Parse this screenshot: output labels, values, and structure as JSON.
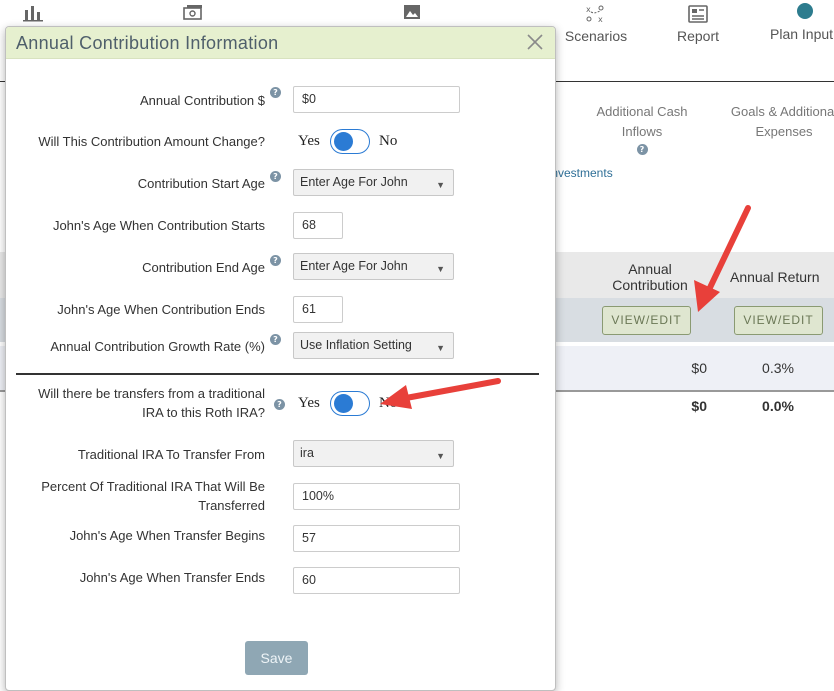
{
  "nav": {
    "items": [
      {
        "label": "",
        "icon": "bar-chart-icon"
      },
      {
        "label": "",
        "icon": "money-icon"
      },
      {
        "label": "",
        "icon": "image-icon"
      },
      {
        "label": "Scenarios",
        "icon": "scenarios-icon"
      },
      {
        "label": "Report",
        "icon": "report-icon"
      },
      {
        "label": "Plan Input",
        "icon": "plan-input-icon"
      }
    ]
  },
  "subtabs": {
    "additional_cash_inflows": "Additional Cash Inflows",
    "goals_expenses": "Goals & Additional Expenses",
    "investments": "Investments"
  },
  "bg_table": {
    "headers": {
      "annual_contribution": "Annual Contribution",
      "annual_return": "Annual Return"
    },
    "view_edit": "VIEW/EDIT",
    "row": {
      "contribution": "$0",
      "return": "0.3%"
    },
    "totals": {
      "contribution": "$0",
      "return": "0.0%"
    }
  },
  "modal": {
    "title": "Annual Contribution Information",
    "fields": {
      "annual_contribution": {
        "label": "Annual Contribution $",
        "value": "$0"
      },
      "amount_change": {
        "label": "Will This Contribution Amount Change?",
        "yes": "Yes",
        "no": "No",
        "state": "off"
      },
      "start_age": {
        "label": "Contribution Start Age",
        "value": "Enter Age For John"
      },
      "age_when_starts": {
        "label": "John's Age When Contribution Starts",
        "value": "68"
      },
      "end_age": {
        "label": "Contribution End Age",
        "value": "Enter Age For John"
      },
      "age_when_ends": {
        "label": "John's Age When Contribution Ends",
        "value": "61"
      },
      "growth_rate": {
        "label": "Annual Contribution Growth Rate (%)",
        "value": "Use Inflation Setting"
      },
      "transfers": {
        "label": "Will there be transfers from a traditional IRA to this Roth IRA?",
        "yes": "Yes",
        "no": "No",
        "state": "off"
      },
      "transfer_from": {
        "label": "Traditional IRA To Transfer From",
        "value": "ira"
      },
      "percent_transferred": {
        "label": "Percent Of Traditional IRA That Will Be Transferred",
        "value": "100%"
      },
      "transfer_begins": {
        "label": "John's Age When Transfer Begins",
        "value": "57"
      },
      "transfer_ends": {
        "label": "John's Age When Transfer Ends",
        "value": "60"
      }
    },
    "save_label": "Save"
  },
  "colors": {
    "accent_blue": "#2b7bd4",
    "header_green": "#e6f0cf",
    "annotation_red": "#e8403a",
    "save_gray": "#8fa7b4"
  }
}
